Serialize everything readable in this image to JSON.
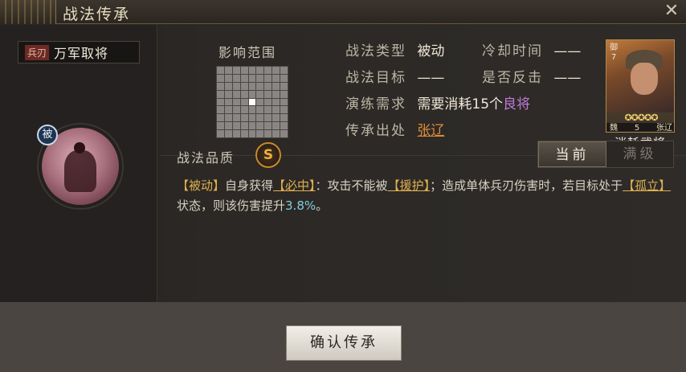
{
  "window": {
    "title": "战法传承",
    "close_icon": "close-icon"
  },
  "skill": {
    "tag": "兵刃",
    "name": "万军取将",
    "type_badge": "被"
  },
  "range": {
    "label": "影响范围",
    "grid_size": 9
  },
  "info": {
    "type_label": "战法类型",
    "type_value": "被动",
    "cooldown_label": "冷却时间",
    "cooldown_value": "——",
    "target_label": "战法目标",
    "target_value": "——",
    "counter_label": "是否反击",
    "counter_value": "——",
    "practice_label": "演练需求",
    "practice_prefix": "需要消耗",
    "practice_count": "15个",
    "practice_item": "良将",
    "source_label": "传承出处",
    "source_value": "张辽"
  },
  "general_card": {
    "side_text": "御7",
    "stars": "✪✪✪✪✪",
    "faction": "魏",
    "cost": "5",
    "name": "张辽",
    "caption": "消耗武将"
  },
  "quality": {
    "label": "战法品质",
    "grade": "S"
  },
  "tabs": {
    "current": "当前",
    "max": "满级"
  },
  "description": {
    "p1": "【被动】",
    "p2": "自身获得",
    "p3": "【必中】",
    "p4": "：攻击不能被",
    "p5": "【援护】",
    "p6": "；造成单体兵刃伤害时，若目标处于",
    "p7": "【孤立】",
    "p8": "状态，则该伤害提升",
    "p9": "3.8%",
    "p10": "。"
  },
  "footer": {
    "confirm_label": "确认传承"
  },
  "colors": {
    "accent_gold": "#e0b050",
    "link_orange": "#e08a3a",
    "purple": "#c07ad8",
    "number_cyan": "#7fcfe0"
  }
}
